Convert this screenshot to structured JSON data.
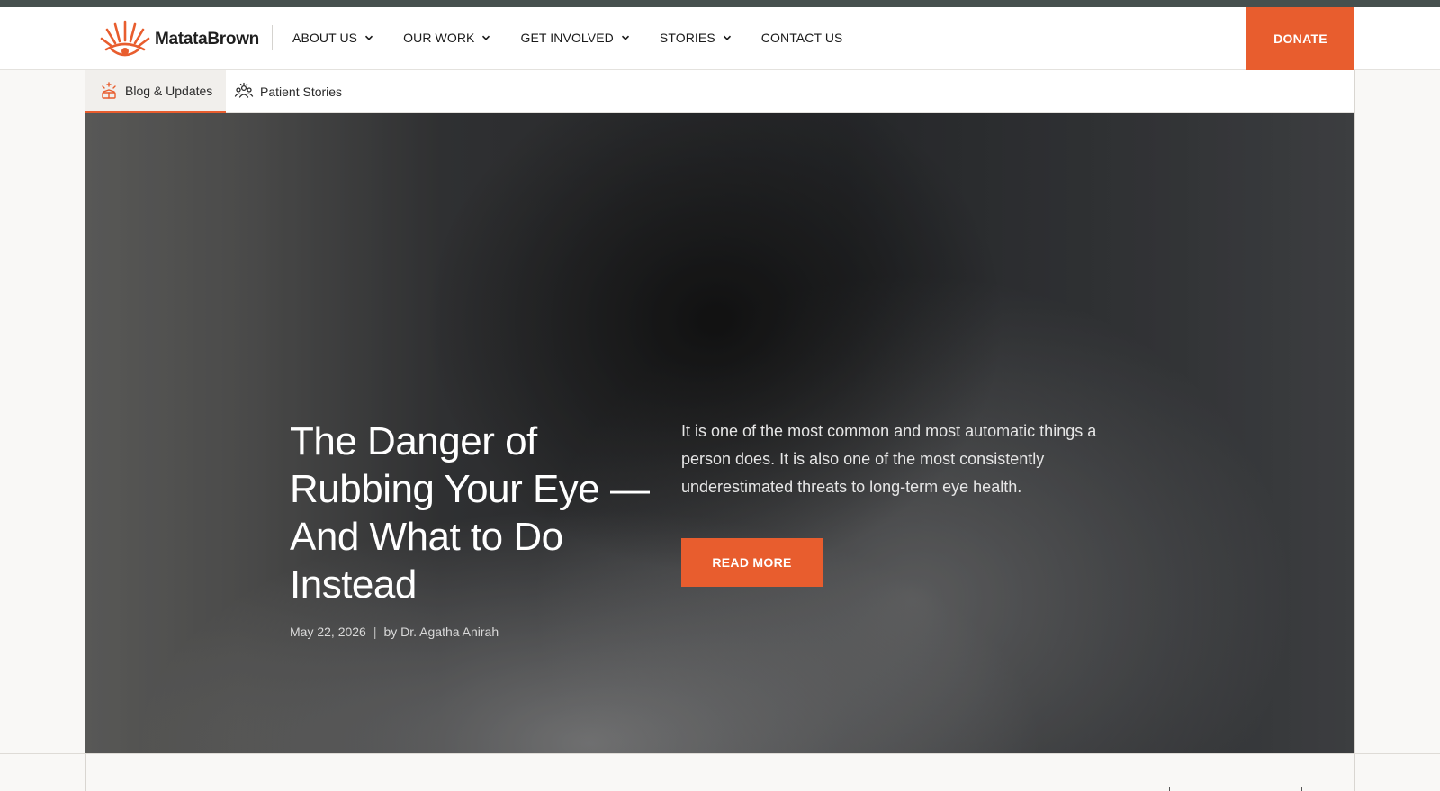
{
  "brand": {
    "name": "MatataBrown",
    "accent_color": "#e85d2e",
    "logo_icon": "sunburst-eye-icon"
  },
  "nav": {
    "items": [
      {
        "label": "ABOUT US",
        "has_dropdown": true
      },
      {
        "label": "OUR WORK",
        "has_dropdown": true
      },
      {
        "label": "GET INVOLVED",
        "has_dropdown": true
      },
      {
        "label": "STORIES",
        "has_dropdown": true
      },
      {
        "label": "CONTACT US",
        "has_dropdown": false
      }
    ],
    "donate_label": "DONATE"
  },
  "subnav": {
    "tabs": [
      {
        "label": "Blog & Updates",
        "icon": "blog-sparkle-icon",
        "active": true
      },
      {
        "label": "Patient Stories",
        "icon": "people-group-icon",
        "active": false
      }
    ]
  },
  "hero": {
    "title": "The Danger of Rubbing Your Eye — And What to Do Instead",
    "date": "May 22, 2026",
    "separator": "|",
    "author": "by Dr. Agatha Anirah",
    "excerpt": "It is one of the most common and most automatic things a person does. It is also one of the most consistently underestimated threats to long-term eye health.",
    "cta_label": "READ MORE"
  }
}
